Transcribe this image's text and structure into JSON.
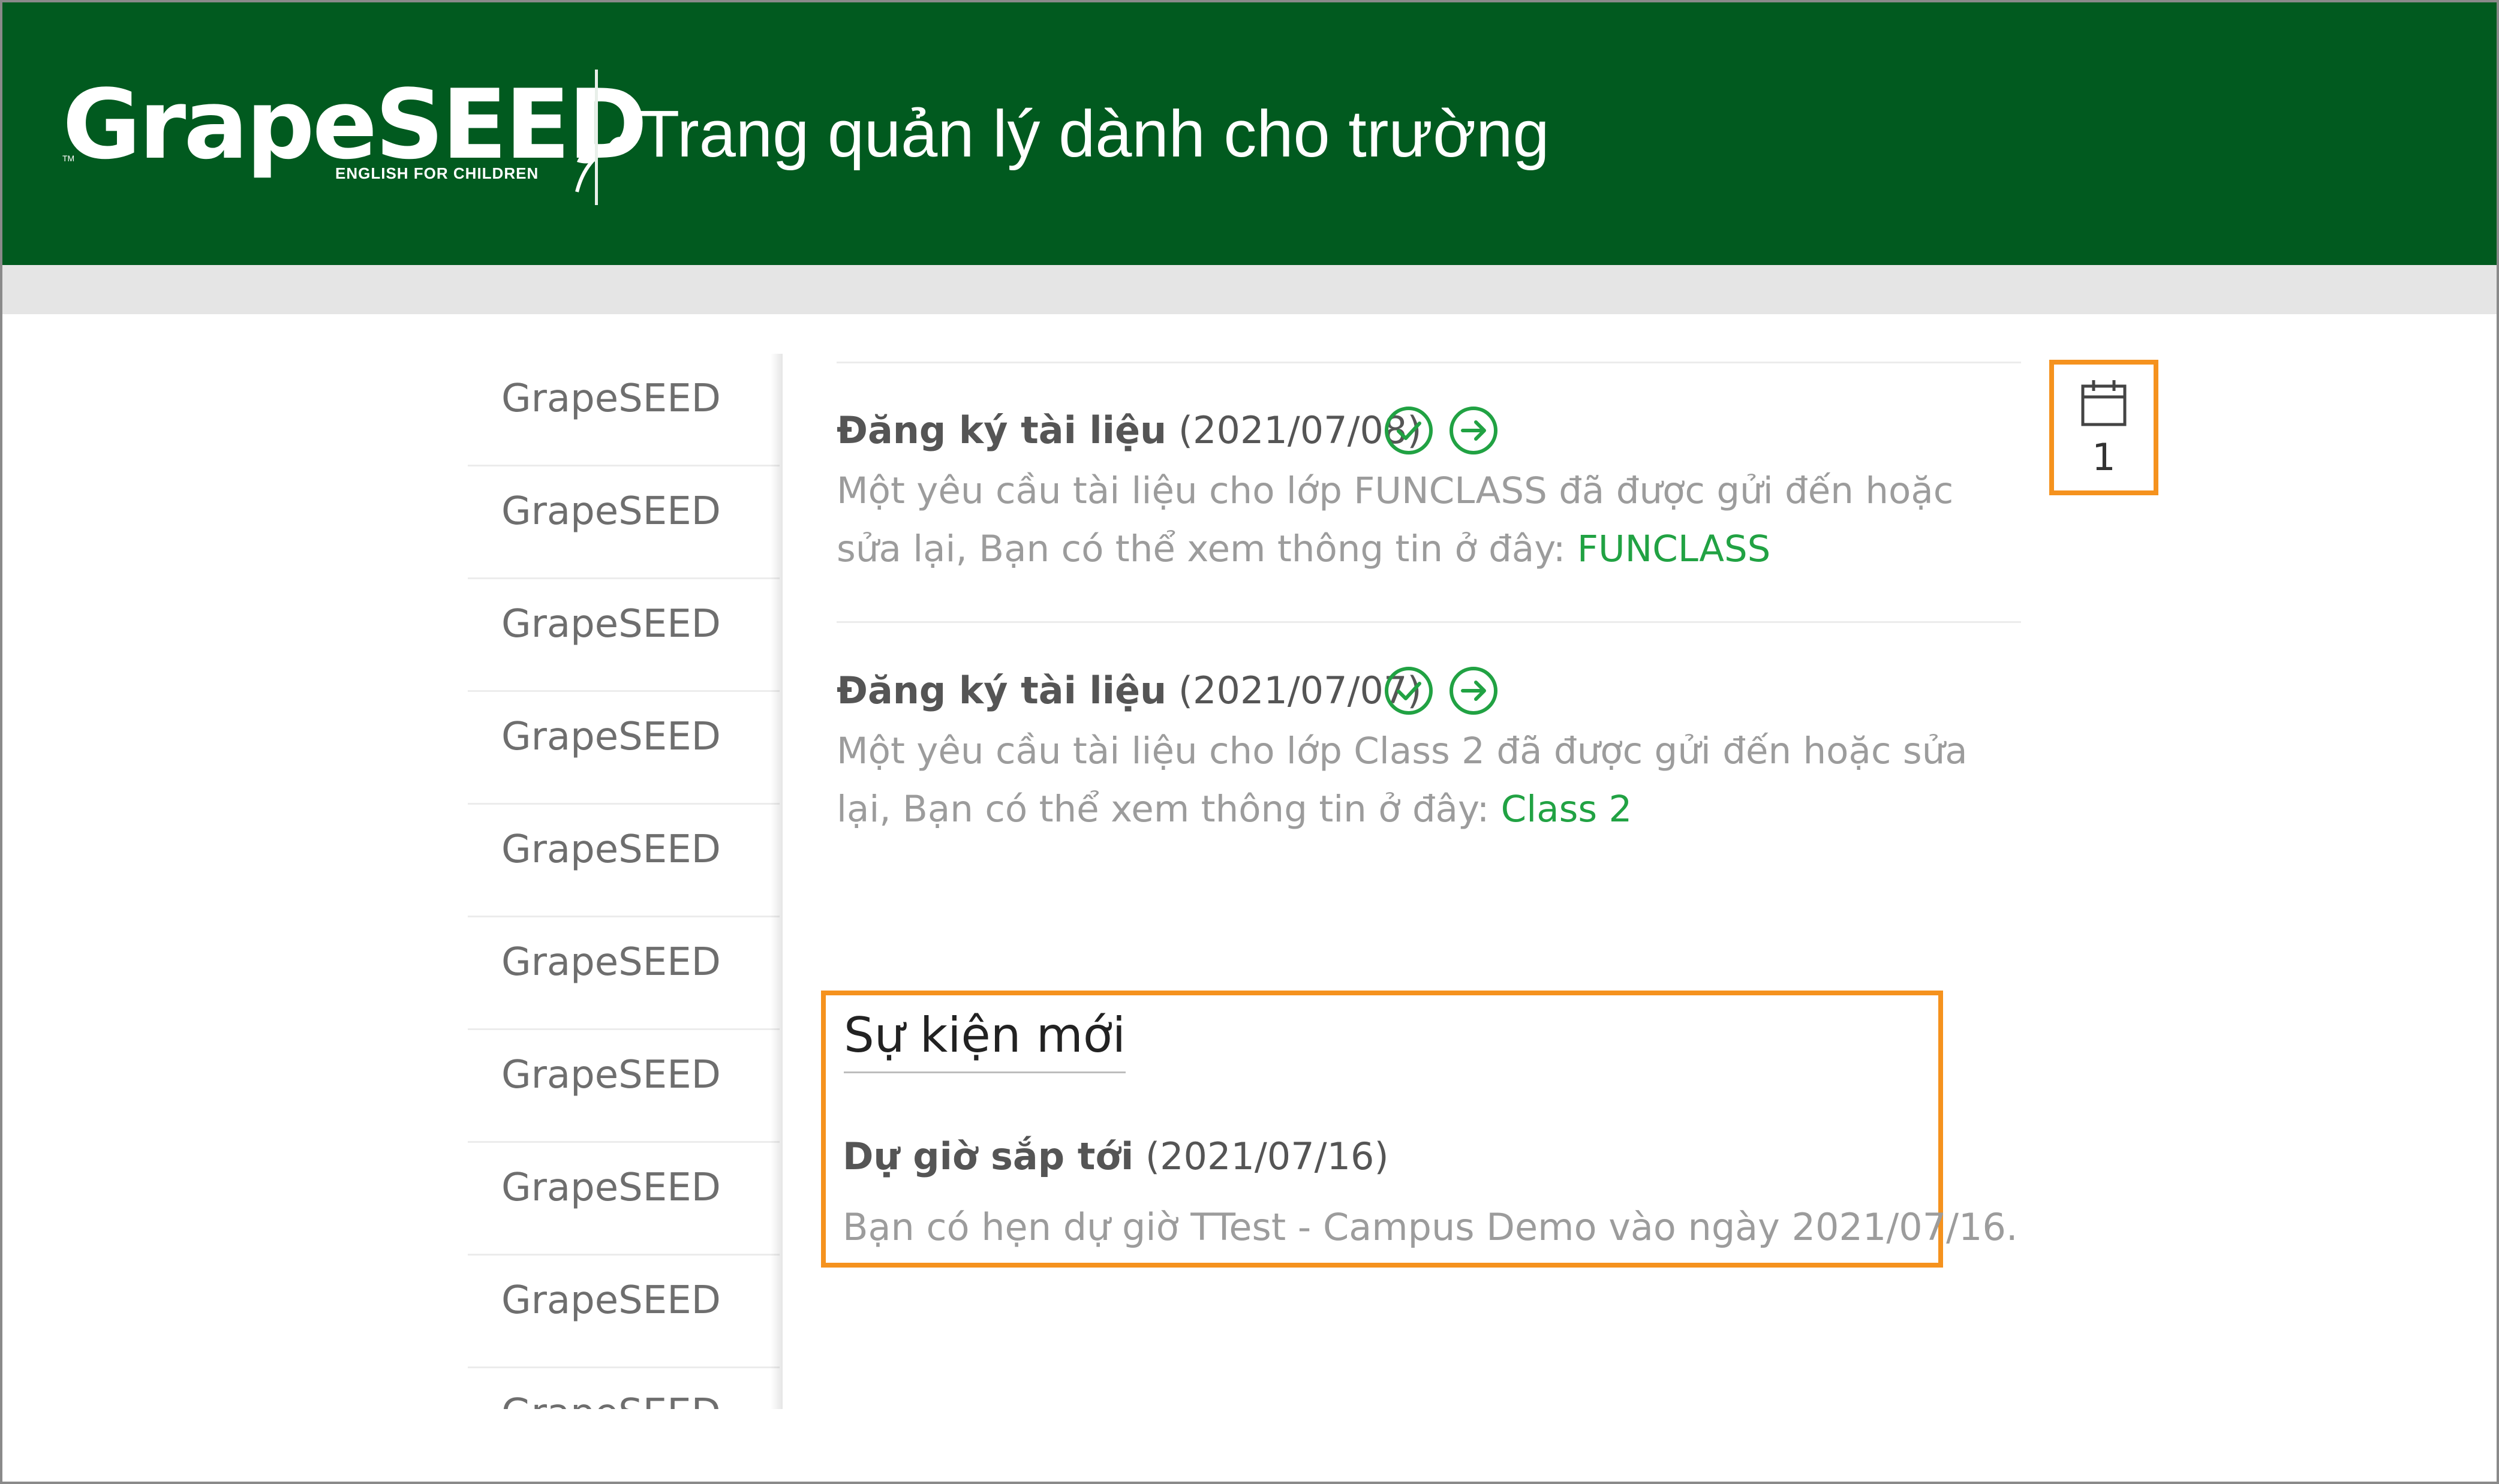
{
  "header": {
    "logo_text": "GrapeSEED",
    "logo_tagline": "ENGLISH FOR CHILDREN",
    "logo_tm": "TM",
    "title": "Trang quản lý dành cho trường"
  },
  "sidebar": {
    "items": [
      {
        "label": "GrapeSEED"
      },
      {
        "label": "GrapeSEED"
      },
      {
        "label": "GrapeSEED"
      },
      {
        "label": "GrapeSEED"
      },
      {
        "label": "GrapeSEED"
      },
      {
        "label": "GrapeSEED"
      },
      {
        "label": "GrapeSEED"
      },
      {
        "label": "GrapeSEED"
      },
      {
        "label": "GrapeSEED"
      },
      {
        "label": "GrapeSEED"
      }
    ]
  },
  "notifications": [
    {
      "title_bold": "Đăng ký tài liệu",
      "title_date": "(2021/07/08)",
      "body_prefix": "Một yêu cầu tài liệu cho lớp FUNCLASS đã được gửi đến hoặc sửa lại, Bạn có thể xem thông tin ở đây: ",
      "link": "FUNCLASS",
      "check_icon": "check-circle-icon",
      "arrow_icon": "arrow-right-circle-icon"
    },
    {
      "title_bold": "Đăng ký tài liệu",
      "title_date": "(2021/07/07)",
      "body_prefix": "Một yêu cầu tài liệu cho lớp Class 2 đã được gửi đến hoặc sửa lại, Bạn có thể xem thông tin ở đây: ",
      "link": "Class 2",
      "check_icon": "check-circle-icon",
      "arrow_icon": "arrow-right-circle-icon"
    }
  ],
  "calendar": {
    "icon": "calendar-icon",
    "count": "1"
  },
  "events": {
    "heading": "Sự kiện mới",
    "item": {
      "title_bold": "Dự giờ sắp tới",
      "title_date": "(2021/07/16)",
      "body": "Bạn có hẹn dự giờ TTest - Campus Demo vào ngày 2021/07/16."
    }
  },
  "colors": {
    "header_bg": "#015a1f",
    "accent_green": "#21a243",
    "highlight_orange": "#f5921e"
  }
}
